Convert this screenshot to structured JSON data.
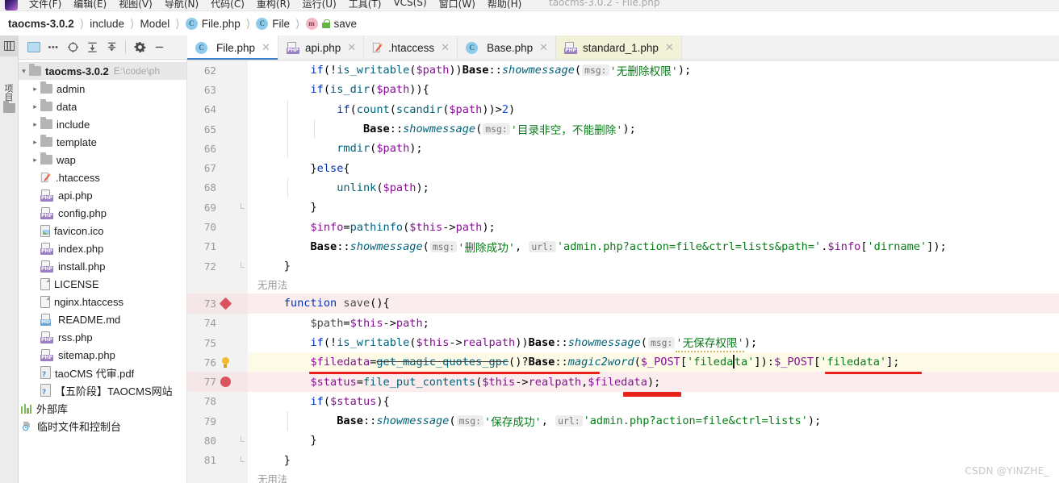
{
  "window": {
    "title": "taocms-3.0.2 - File.php",
    "menu": [
      "文件(F)",
      "编辑(E)",
      "视图(V)",
      "导航(N)",
      "代码(C)",
      "重构(R)",
      "运行(U)",
      "工具(T)",
      "VCS(S)",
      "窗口(W)",
      "帮助(H)"
    ]
  },
  "breadcrumb": [
    {
      "label": "taocms-3.0.2",
      "icon": "none",
      "bold": true
    },
    {
      "label": "include",
      "icon": "none",
      "bold": false
    },
    {
      "label": "Model",
      "icon": "none",
      "bold": false
    },
    {
      "label": "File.php",
      "icon": "class-icon",
      "bold": false
    },
    {
      "label": "File",
      "icon": "class-icon",
      "bold": false
    },
    {
      "label": "save",
      "icon": "method-icon",
      "bold": false
    }
  ],
  "toolstrip": {
    "project_label": "项目",
    "buttons": [
      "project-tool-window-icon",
      "structure-tool-window-icon",
      "folder-icon"
    ]
  },
  "project_toolbar": {
    "buttons": [
      "select-opened-file-icon",
      "more-options-icon",
      "locate-icon",
      "expand-all-icon",
      "collapse-all-icon",
      "settings-icon",
      "hide-icon"
    ]
  },
  "tree": {
    "root": {
      "label": "taocms-3.0.2",
      "path": "E:\\code\\ph",
      "icon": "folder-icon",
      "expanded": true
    },
    "items": [
      {
        "label": "admin",
        "icon": "folder-icon",
        "indent": 1,
        "chevron": "right"
      },
      {
        "label": "data",
        "icon": "folder-icon",
        "indent": 1,
        "chevron": "right"
      },
      {
        "label": "include",
        "icon": "folder-icon",
        "indent": 1,
        "chevron": "right"
      },
      {
        "label": "template",
        "icon": "folder-icon",
        "indent": 1,
        "chevron": "right"
      },
      {
        "label": "wap",
        "icon": "folder-icon",
        "indent": 1,
        "chevron": "right"
      },
      {
        "label": ".htaccess",
        "icon": "htaccess-icon",
        "indent": 1,
        "chevron": ""
      },
      {
        "label": "api.php",
        "icon": "php-file-icon",
        "indent": 1,
        "chevron": ""
      },
      {
        "label": "config.php",
        "icon": "php-file-icon",
        "indent": 1,
        "chevron": ""
      },
      {
        "label": "favicon.ico",
        "icon": "image-file-icon",
        "indent": 1,
        "chevron": ""
      },
      {
        "label": "index.php",
        "icon": "php-file-icon",
        "indent": 1,
        "chevron": ""
      },
      {
        "label": "install.php",
        "icon": "php-file-icon",
        "indent": 1,
        "chevron": ""
      },
      {
        "label": "LICENSE",
        "icon": "text-file-icon",
        "indent": 1,
        "chevron": ""
      },
      {
        "label": "nginx.htaccess",
        "icon": "text-file-icon",
        "indent": 1,
        "chevron": ""
      },
      {
        "label": "README.md",
        "icon": "md-file-icon",
        "indent": 1,
        "chevron": ""
      },
      {
        "label": "rss.php",
        "icon": "php-file-icon",
        "indent": 1,
        "chevron": ""
      },
      {
        "label": "sitemap.php",
        "icon": "php-file-icon",
        "indent": 1,
        "chevron": ""
      },
      {
        "label": "taoCMS 代审.pdf",
        "icon": "unknown-file-icon",
        "indent": 1,
        "chevron": ""
      },
      {
        "label": "【五阶段】TAOCMS网站",
        "icon": "unknown-file-icon",
        "indent": 1,
        "chevron": ""
      },
      {
        "label": "外部库",
        "icon": "external-libraries-icon",
        "indent": 0,
        "chevron": ""
      },
      {
        "label": "临时文件和控制台",
        "icon": "scratches-icon",
        "indent": 0,
        "chevron": ""
      }
    ]
  },
  "tabs": [
    {
      "label": "File.php",
      "icon": "class-icon",
      "active": true,
      "tinted": false
    },
    {
      "label": "api.php",
      "icon": "php-file-icon",
      "active": false,
      "tinted": false
    },
    {
      "label": ".htaccess",
      "icon": "htaccess-icon",
      "active": false,
      "tinted": false
    },
    {
      "label": "Base.php",
      "icon": "class-icon",
      "active": false,
      "tinted": false
    },
    {
      "label": "standard_1.php",
      "icon": "php-file-icon",
      "active": false,
      "tinted": true
    }
  ],
  "editor": {
    "first_line": 62,
    "lines": [
      {
        "num": "62",
        "text": "        if(!is_writable($path))Base::showmessage( msg: '无删除权限');"
      },
      {
        "num": "63",
        "text": "        if(is_dir($path)){"
      },
      {
        "num": "64",
        "text": "            if(count(scandir($path))>2)"
      },
      {
        "num": "65",
        "text": "                Base::showmessage( msg: '目录非空，不能删除');"
      },
      {
        "num": "66",
        "text": "            rmdir($path);"
      },
      {
        "num": "67",
        "text": "        }else{"
      },
      {
        "num": "68",
        "text": "            unlink($path);"
      },
      {
        "num": "69",
        "text": "        }"
      },
      {
        "num": "70",
        "text": "        $info=pathinfo($this->path);"
      },
      {
        "num": "71",
        "text": "        Base::showmessage( msg: '删除成功', url: 'admin.php?action=file&ctrl=lists&path='.$info['dirname']);"
      },
      {
        "num": "72",
        "text": "    }"
      },
      {
        "num": "",
        "text": "无用法"
      },
      {
        "num": "73",
        "text": "    function save(){"
      },
      {
        "num": "74",
        "text": "        $path=$this->path;"
      },
      {
        "num": "75",
        "text": "        if(!is_writable($this->realpath))Base::showmessage( msg: '无保存权限');"
      },
      {
        "num": "76",
        "text": "        $filedata=get_magic_quotes_gpc()?Base::magic2word($_POST['filedata']):$_POST['filedata'];"
      },
      {
        "num": "77",
        "text": "        $status=file_put_contents($this->realpath,$filedata);"
      },
      {
        "num": "78",
        "text": "        if($status){"
      },
      {
        "num": "79",
        "text": "            Base::showmessage( msg: '保存成功', url: 'admin.php?action=file&ctrl=lists');"
      },
      {
        "num": "80",
        "text": "        }"
      },
      {
        "num": "81",
        "text": "    }"
      },
      {
        "num": "",
        "text": "无用法"
      }
    ],
    "inlay_hints": [
      "msg:",
      "url:"
    ],
    "usage_label": "无用法",
    "gutter_markers": [
      {
        "line": "73",
        "marker": "method-separator-diamond-icon"
      },
      {
        "line": "76",
        "marker": "intention-bulb-icon"
      },
      {
        "line": "77",
        "marker": "breakpoint-icon"
      }
    ]
  },
  "colors": {
    "keyword": "#0033b3",
    "string": "#067d17",
    "function": "#00627a",
    "variable": "#871094",
    "number": "#1750eb",
    "annotation_red": "#e8201a",
    "line_highlight_pink": "#fbeded",
    "line_highlight_cream": "#fdfbe8",
    "tab_active_underline": "#4083c9"
  },
  "watermark": "CSDN @YINZHE_"
}
